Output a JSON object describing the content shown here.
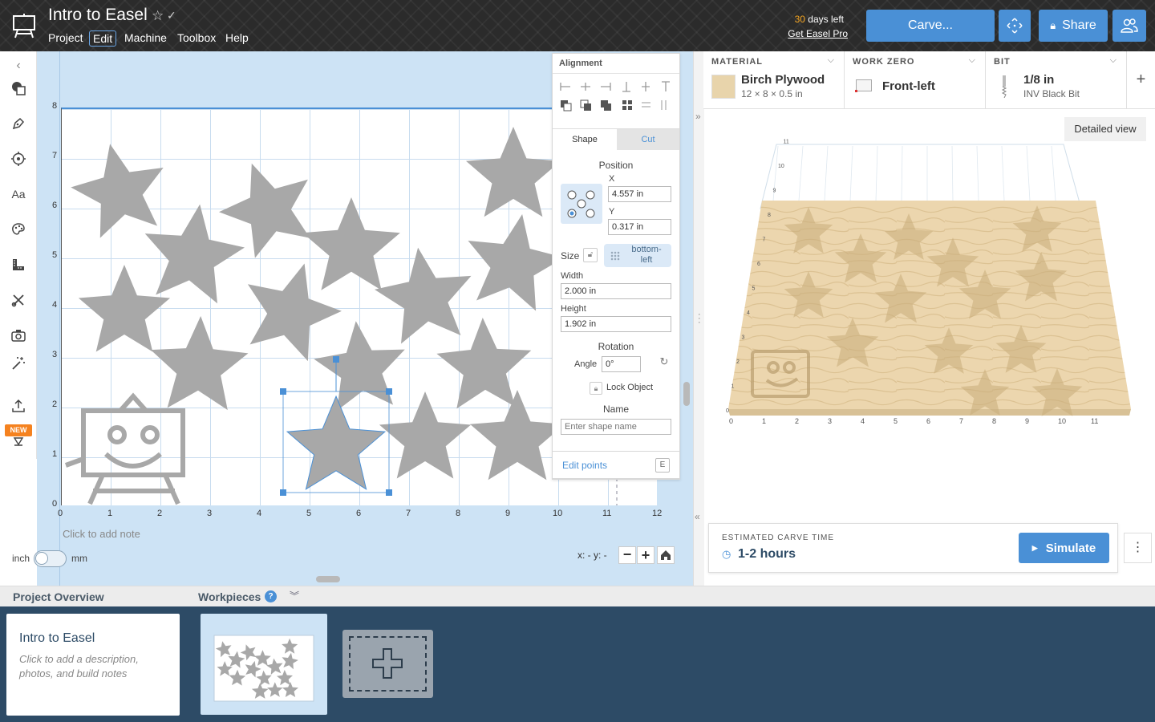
{
  "app": {
    "project_title": "Intro to Easel"
  },
  "menu": [
    "Project",
    "Edit",
    "Machine",
    "Toolbox",
    "Help"
  ],
  "trial": {
    "days_number": "30",
    "days_suffix": " days left",
    "link": "Get Easel Pro"
  },
  "header_buttons": {
    "carve": "Carve...",
    "share": "Share"
  },
  "left_tools": [
    "shapes-icon",
    "pen-icon",
    "target-icon",
    "text-icon",
    "palette-icon",
    "ruler-icon",
    "cut-tools-icon",
    "camera-icon",
    "magic-wand-icon",
    "upload-icon",
    "collapse-down-icon"
  ],
  "new_badge": "NEW",
  "canvas": {
    "x_ticks": [
      "0",
      "1",
      "2",
      "3",
      "4",
      "5",
      "6",
      "7",
      "8",
      "9",
      "10",
      "11",
      "12"
    ],
    "y_ticks": [
      "0",
      "1",
      "2",
      "3",
      "4",
      "5",
      "6",
      "7",
      "8"
    ],
    "note_placeholder": "Click to add note",
    "unit_left": "inch",
    "unit_right": "mm",
    "coords": "x: - y: -"
  },
  "panel": {
    "alignment_title": "Alignment",
    "tab_shape": "Shape",
    "tab_cut": "Cut",
    "position_label": "Position",
    "x_label": "X",
    "x_value": "4.557 in",
    "y_label": "Y",
    "y_value": "0.317 in",
    "size_label": "Size",
    "anchor": "bottom-\nleft",
    "width_label": "Width",
    "width_value": "2.000 in",
    "height_label": "Height",
    "height_value": "1.902 in",
    "rotation_label": "Rotation",
    "angle_label": "Angle",
    "angle_value": "0°",
    "lock_label": "Lock Object",
    "name_label": "Name",
    "name_placeholder": "Enter shape name",
    "edit_points": "Edit points",
    "edit_points_key": "E"
  },
  "material": {
    "header": "MATERIAL",
    "name": "Birch Plywood",
    "dims": "12 × 8 × 0.5 in",
    "swatch_color": "#e8d4ab"
  },
  "work_zero": {
    "header": "WORK ZERO",
    "value": "Front-left"
  },
  "bit": {
    "header": "BIT",
    "size": "1/8 in",
    "name": "INV Black Bit"
  },
  "preview": {
    "detailed_view": "Detailed view",
    "x_ticks": [
      "0",
      "1",
      "2",
      "3",
      "4",
      "5",
      "6",
      "7",
      "8",
      "9",
      "10",
      "11"
    ],
    "y_ticks": [
      "0",
      "1",
      "2",
      "3",
      "4",
      "5",
      "6",
      "7",
      "8",
      "9",
      "10",
      "11"
    ]
  },
  "carve_time": {
    "label": "ESTIMATED CARVE TIME",
    "value": "1-2 hours",
    "simulate": "Simulate"
  },
  "bottom": {
    "project_overview": "Project Overview",
    "workpieces": "Workpieces",
    "card_title": "Intro to Easel",
    "card_desc": "Click to add a description, photos, and build notes"
  },
  "colors": {
    "accent": "#4a90d6",
    "topbar": "#2b2b2b",
    "canvas_bg": "#cde3f5",
    "star": "#a8a8a8",
    "bottom_panel": "#2d4b66",
    "trial_days": "#f5a623",
    "new_badge": "#f5821f"
  }
}
